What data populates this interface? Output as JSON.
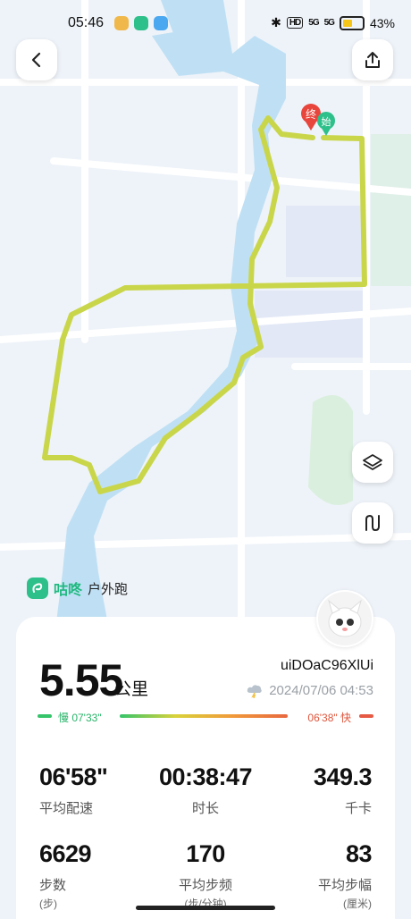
{
  "status_bar": {
    "time": "05:46",
    "battery": "43%",
    "hd_label": "HD",
    "signal_label": "5G"
  },
  "route_markers": {
    "end": "终",
    "start": "始"
  },
  "brand": {
    "name": "咕咚",
    "activity_type": "户外跑"
  },
  "summary": {
    "distance": "5.55",
    "distance_unit": "公里",
    "username": "uiDOaC96XlUi",
    "datetime": "2024/07/06 04:53"
  },
  "pace_scale": {
    "slow_label": "慢 07'33\"",
    "fast_label": "06'38\" 快"
  },
  "stats_row1": [
    {
      "value": "06'58\"",
      "label": "平均配速"
    },
    {
      "value": "00:38:47",
      "label": "时长"
    },
    {
      "value": "349.3",
      "label": "千卡"
    }
  ],
  "stats_row2": [
    {
      "value": "6629",
      "label": "步数",
      "sub": "(步)"
    },
    {
      "value": "170",
      "label": "平均步频",
      "sub": "(步/分钟)"
    },
    {
      "value": "83",
      "label": "平均步幅",
      "sub": "(厘米)"
    }
  ],
  "colors": {
    "route": "#c9d64a",
    "water": "#bfe0f4",
    "brand": "#21b981",
    "end_marker": "#e8453c",
    "start_marker": "#2ec08a"
  },
  "icons": {
    "back": "chevron-left-icon",
    "share": "share-icon",
    "layers": "layers-icon",
    "replay": "route-replay-icon"
  }
}
